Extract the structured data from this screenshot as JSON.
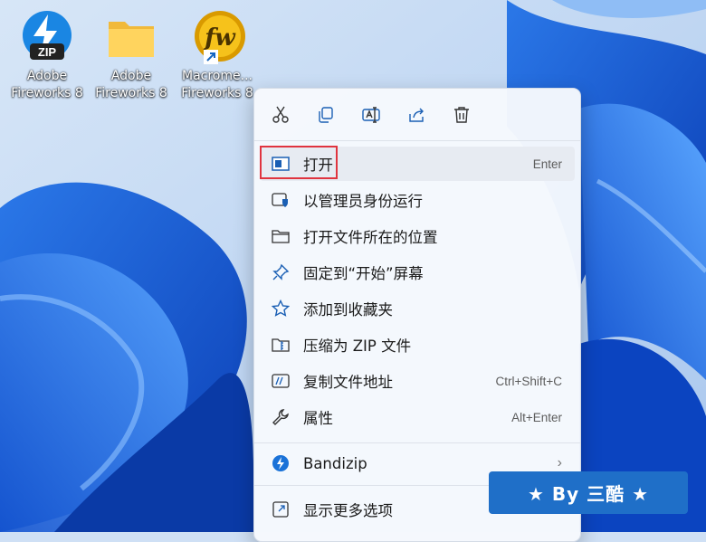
{
  "desktop": {
    "icons": [
      {
        "line1": "Adobe",
        "line2": "Fireworks 8",
        "badge": "ZIP",
        "icon": "bandizip-archive-icon"
      },
      {
        "line1": "Adobe",
        "line2": "Fireworks 8",
        "icon": "folder-icon"
      },
      {
        "line1": "Macrome...",
        "line2": "Fireworks 8",
        "icon": "fireworks-shortcut-icon"
      }
    ]
  },
  "context_menu": {
    "toolbar": [
      {
        "action": "cut",
        "icon": "scissors-icon"
      },
      {
        "action": "copy",
        "icon": "copy-icon"
      },
      {
        "action": "rename",
        "icon": "rename-icon"
      },
      {
        "action": "share",
        "icon": "share-icon"
      },
      {
        "action": "delete",
        "icon": "trash-icon"
      }
    ],
    "items": [
      {
        "label": "打开",
        "shortcut": "Enter",
        "icon": "open-window-icon",
        "selected": true
      },
      {
        "label": "以管理员身份运行",
        "shortcut": "",
        "icon": "admin-shield-icon"
      },
      {
        "label": "打开文件所在的位置",
        "shortcut": "",
        "icon": "folder-icon"
      },
      {
        "label": "固定到“开始”屏幕",
        "shortcut": "",
        "icon": "pin-icon"
      },
      {
        "label": "添加到收藏夹",
        "shortcut": "",
        "icon": "star-icon"
      },
      {
        "label": "压缩为 ZIP 文件",
        "shortcut": "",
        "icon": "zip-folder-icon"
      },
      {
        "label": "复制文件地址",
        "shortcut": "Ctrl+Shift+C",
        "icon": "copy-path-icon"
      },
      {
        "label": "属性",
        "shortcut": "Alt+Enter",
        "icon": "wrench-icon"
      },
      {
        "label": "Bandizip",
        "shortcut": "",
        "icon": "bandizip-icon",
        "submenu": true
      },
      {
        "label": "显示更多选项",
        "shortcut": "S",
        "icon": "more-options-icon"
      }
    ]
  },
  "watermark": {
    "text": "★ By 三酷 ★"
  },
  "colors": {
    "accent": "#1f6fc8",
    "highlight": "#e0343f",
    "menu_bg": "#f6f9fd"
  }
}
